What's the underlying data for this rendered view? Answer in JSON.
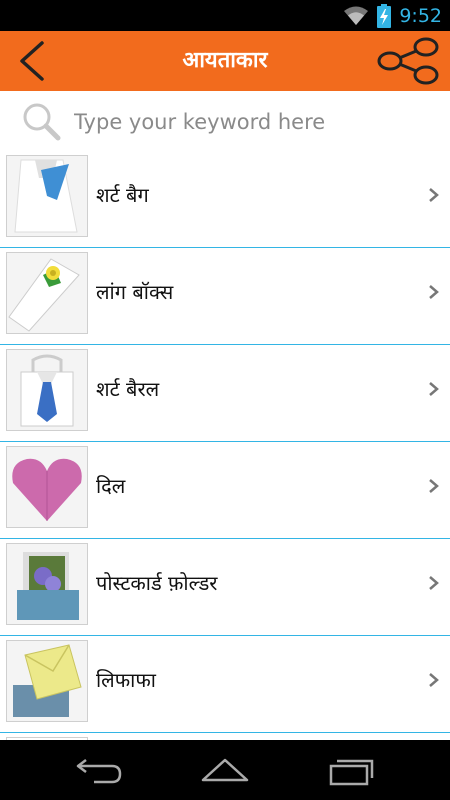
{
  "status": {
    "time": "9:52"
  },
  "header": {
    "title": "आयताकार"
  },
  "search": {
    "placeholder": "Type your keyword here"
  },
  "list": {
    "items": [
      {
        "label": "शर्ट बैग"
      },
      {
        "label": "लांग बॉक्स"
      },
      {
        "label": "शर्ट बैरल"
      },
      {
        "label": "दिल"
      },
      {
        "label": "पोस्टकार्ड फ़ोल्डर"
      },
      {
        "label": "लिफाफा"
      }
    ]
  },
  "colors": {
    "accent": "#f26b1d",
    "divider": "#33b5e5",
    "status_time": "#33b5e5"
  }
}
